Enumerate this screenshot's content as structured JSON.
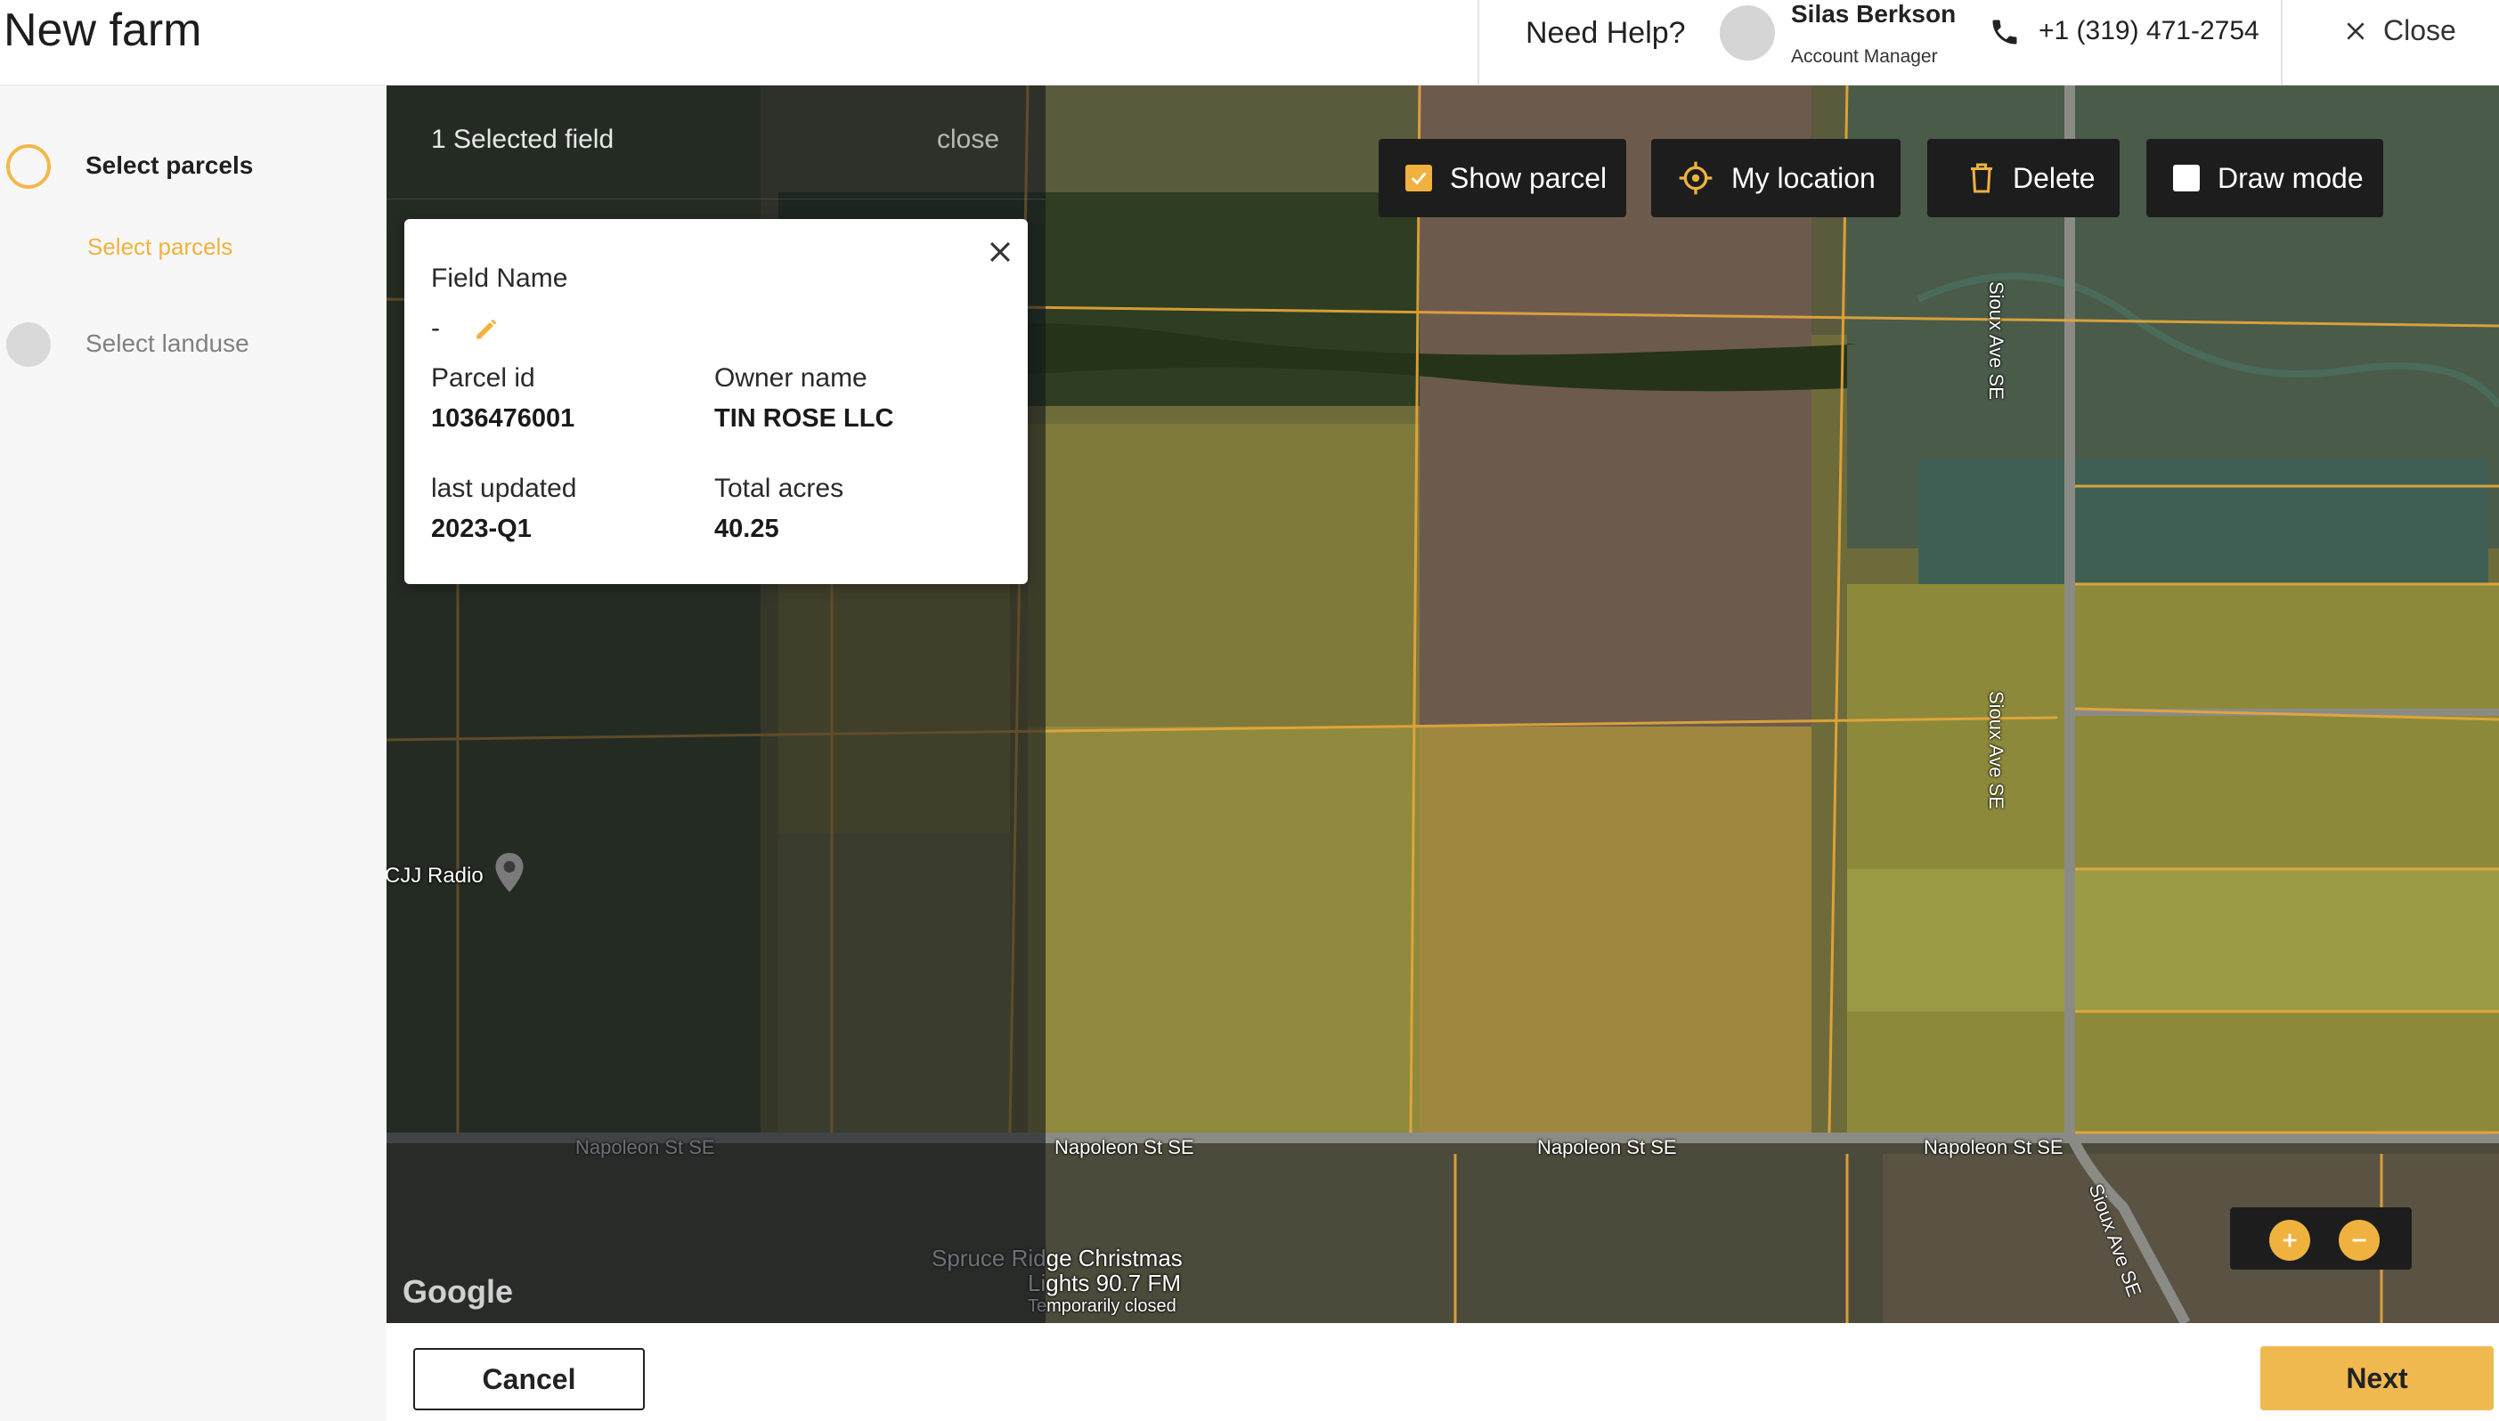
{
  "header": {
    "title": "New farm",
    "need_help": "Need Help?",
    "manager_name": "Silas Berkson",
    "manager_role": "Account Manager",
    "phone": "+1 (319) 471-2754",
    "close_label": "Close"
  },
  "sidebar": {
    "steps": [
      {
        "label": "Select parcels",
        "sub_label": "Select parcels",
        "state": "active"
      },
      {
        "label": "Select landuse",
        "state": "inactive"
      }
    ]
  },
  "selection_panel": {
    "count_label": "1 Selected field",
    "close_label": "close"
  },
  "field_card": {
    "field_name_label": "Field Name",
    "field_name_value": "-",
    "parcel_id_label": "Parcel id",
    "parcel_id_value": "1036476001",
    "owner_label": "Owner name",
    "owner_value": "TIN ROSE LLC",
    "updated_label": "last updated",
    "updated_value": "2023-Q1",
    "acres_label": "Total acres",
    "acres_value": "40.25"
  },
  "map_controls": {
    "show_parcel": {
      "label": "Show parcel",
      "checked": true
    },
    "my_location": {
      "label": "My location",
      "icon": "crosshair-icon"
    },
    "delete": {
      "label": "Delete",
      "icon": "trash-icon"
    },
    "draw_mode": {
      "label": "Draw mode",
      "checked": false
    },
    "zoom_in": "+",
    "zoom_out": "−"
  },
  "map_labels": {
    "road_napoleon": "Napoleon St SE",
    "road_sioux": "Sioux Ave SE",
    "radio_poi": "CJJ Radio",
    "poi_line1": "Spruce Ridge Christmas",
    "poi_line2": "Lights 90.7 FM",
    "poi_line3": "Temporarily closed",
    "google": "Google"
  },
  "footer": {
    "cancel": "Cancel",
    "next": "Next"
  },
  "colors": {
    "accent": "#f0b23f",
    "dark_button": "#1d1d1d",
    "parcel_line": "#e8a73a"
  }
}
